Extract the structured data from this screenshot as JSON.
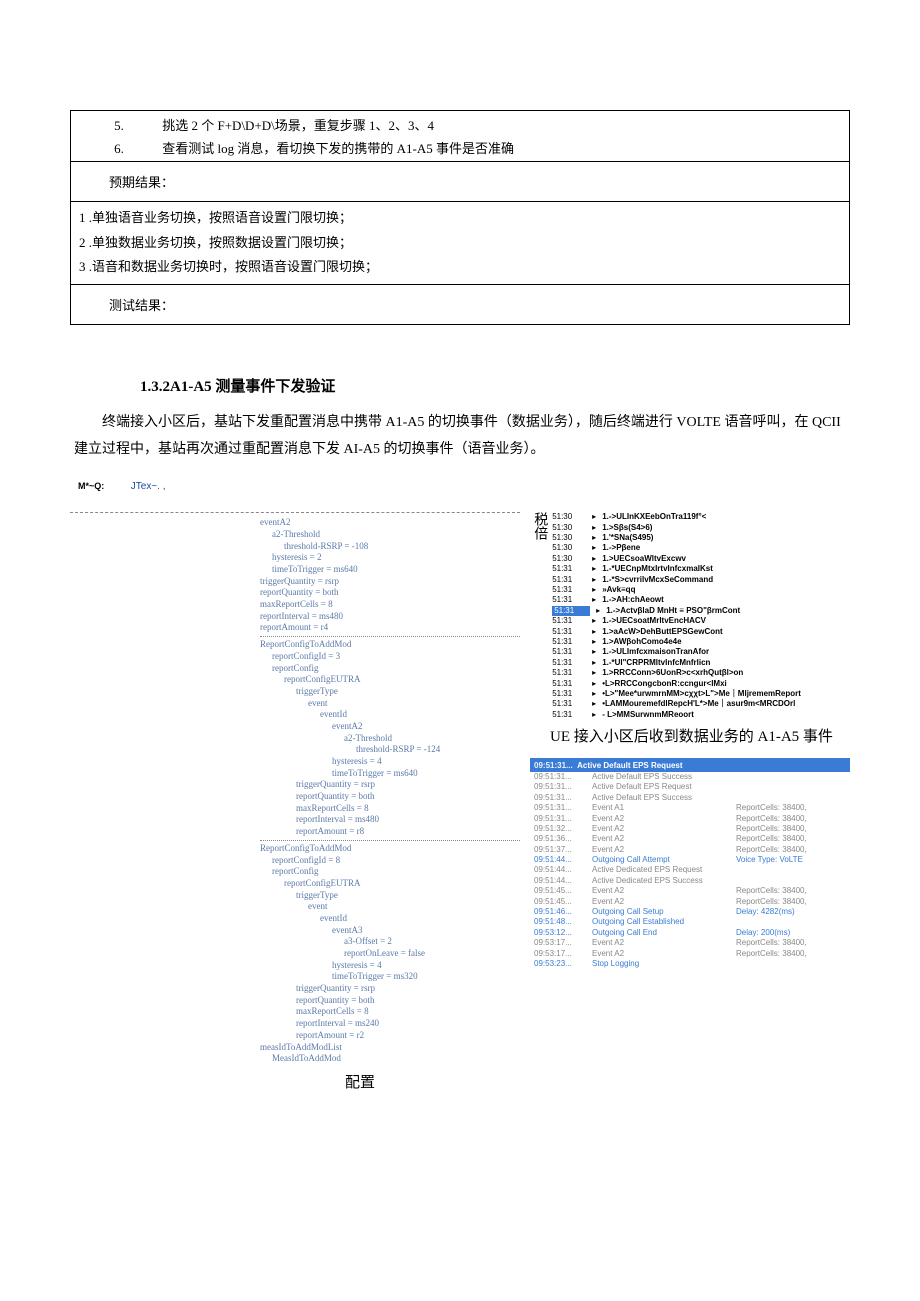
{
  "steps": {
    "s5_num": "5.",
    "s5_text": "挑选 2 个 F+D\\D+D\\场景，重复步骤 1、2、3、4",
    "s6_num": "6.",
    "s6_text": "查看测试 log 消息，看切换下发的携带的 A1-A5 事件是否准确"
  },
  "expected_label": "预期结果：",
  "expected": {
    "l1_num": "1",
    "l1_text": ".单独语音业务切换，按照语音设置门限切换；",
    "l2_num": "2",
    "l2_text": ".单独数据业务切换，按照数据设置门限切换；",
    "l3_num": "3",
    "l3_text": ".语音和数据业务切换时，按照语音设置门限切换；"
  },
  "test_result_label": "测试结果：",
  "section_heading": "1.3.2A1-A5 测量事件下发验证",
  "paragraph": "终端接入小区后，基站下发重配置消息中携带 A1-A5 的切换事件（数据业务），随后终端进行 VOLTE 语音呼叫，在 QCII 建立过程中，基站再次通过重配置消息下发 AI-A5 的切换事件（语音业务）。",
  "top_left_labels": {
    "a": "M*~Q:",
    "b": "JTex~. ,"
  },
  "tree": [
    "eventA2",
    "  a2-Threshold",
    "    threshold-RSRP = -108",
    "  hysteresis = 2",
    "  timeToTrigger = ms640",
    "triggerQuantity = rsrp",
    "reportQuantity = both",
    "maxReportCells = 8",
    "reportInterval = ms480",
    "reportAmount = r4",
    "ReportConfigToAddMod",
    "  reportConfigId = 3",
    "  reportConfig",
    "    reportConfigEUTRA",
    "      triggerType",
    "        event",
    "          eventId",
    "            eventA2",
    "              a2-Threshold",
    "                threshold-RSRP = -124",
    "            hysteresis = 4",
    "            timeToTrigger = ms640",
    "      triggerQuantity = rsrp",
    "      reportQuantity = both",
    "      maxReportCells = 8",
    "      reportInterval = ms480",
    "      reportAmount = r8",
    "ReportConfigToAddMod",
    "  reportConfigId = 8",
    "  reportConfig",
    "    reportConfigEUTRA",
    "      triggerType",
    "        event",
    "          eventId",
    "            eventA3",
    "              a3-Offset = 2",
    "              reportOnLeave = false",
    "            hysteresis = 4",
    "            timeToTrigger = ms320",
    "      triggerQuantity = rsrp",
    "      reportQuantity = both",
    "      maxReportCells = 8",
    "      reportInterval = ms240",
    "      reportAmount = r2",
    "measIdToAddModList",
    "  MeasIdToAddMod"
  ],
  "cjk_side": "税倍",
  "log": [
    {
      "t": "51:30",
      "m": "1.->ULInKXEebOnTra119f°<"
    },
    {
      "t": "51:30",
      "m": "1.>Sβs(S4>6)"
    },
    {
      "t": "51:30",
      "m": "1.'*SNa(S495)"
    },
    {
      "t": "51:30",
      "m": "1.->Pβene"
    },
    {
      "t": "51:30",
      "m": "1.>UECsoaWltvExcwv"
    },
    {
      "t": "51:31",
      "m": "1.-*UECnpMtxIrtvInfcxmalKst"
    },
    {
      "t": "51:31",
      "m": "1.-*S>cvrrilvMcxSeCommand"
    },
    {
      "t": "51:31",
      "m": "»Avk≡qq"
    },
    {
      "t": "51:31",
      "m": "1.->AH:chAeowt"
    },
    {
      "t": "51:31",
      "m": "1.->ActvβlaD MnHt ≡ PSO\"βrmCont",
      "hl": true
    },
    {
      "t": "51:31",
      "m": "1.->UECsoatMrltvEncHACV"
    },
    {
      "t": "51:31",
      "m": "1.>aAcW>DehButtEPSGewCont"
    },
    {
      "t": "51:31",
      "m": "1.>AWβohComo4e4e"
    },
    {
      "t": "51:31",
      "m": "1.->ULImfcxmaisonTranAfor"
    },
    {
      "t": "51:31",
      "m": "1.-*UI\"CRPRMltvInfcMnfrlicn"
    },
    {
      "t": "51:31",
      "m": "1.>RRCConn>6UonR>c<xrhQutβl>on"
    },
    {
      "t": "51:31",
      "m": "•L>RRCCongcbonR:ccngur<IMxi"
    },
    {
      "t": "51:31",
      "m": "•L>\"Mee*urwmrnMM>cχχt>L\">Me｜MljrememReport"
    },
    {
      "t": "51:31",
      "m": "•LAMMouremefdlRepcH'L*>Me｜asur9m<MRCDOrl"
    },
    {
      "t": "51:31",
      "m": "- L>MMSurwnmMReoort"
    }
  ],
  "caption_right": "UE 接入小区后收到数据业务的 A1-A5 事件",
  "event_header": "Active Default EPS Request",
  "events": [
    {
      "t": "09:51:31...",
      "m": "Active Default EPS Success",
      "i": ""
    },
    {
      "t": "09:51:31...",
      "m": "Active Default EPS Request",
      "i": ""
    },
    {
      "t": "09:51:31...",
      "m": "Active Default EPS Success",
      "i": ""
    },
    {
      "t": "09:51:31...",
      "m": "Event A1",
      "i": "ReportCells: 38400,"
    },
    {
      "t": "09:51:31...",
      "m": "Event A2",
      "i": "ReportCells: 38400,"
    },
    {
      "t": "09:51:32...",
      "m": "Event A2",
      "i": "ReportCells: 38400,"
    },
    {
      "t": "09:51:36...",
      "m": "Event A2",
      "i": "ReportCells: 38400,"
    },
    {
      "t": "09:51:37...",
      "m": "Event A2",
      "i": "ReportCells: 38400,"
    },
    {
      "t": "09:51:44...",
      "m": "Outgoing Call Attempt",
      "i": "Voice Type: VoLTE",
      "blue": true
    },
    {
      "t": "09:51:44...",
      "m": "Active Dedicated EPS Request",
      "i": ""
    },
    {
      "t": "09:51:44...",
      "m": "Active Dedicated EPS Success",
      "i": ""
    },
    {
      "t": "09:51:45...",
      "m": "Event A2",
      "i": "ReportCells: 38400,"
    },
    {
      "t": "09:51:45...",
      "m": "Event A2",
      "i": "ReportCells: 38400,"
    },
    {
      "t": "09:51:46...",
      "m": "Outgoing Call Setup",
      "i": "Delay: 4282(ms)",
      "blue": true
    },
    {
      "t": "09:51:48...",
      "m": "Outgoing Call Established",
      "i": "",
      "blue": true
    },
    {
      "t": "09:53:12...",
      "m": "Outgoing Call End",
      "i": "Delay: 200(ms)",
      "blue": true
    },
    {
      "t": "09:53:17...",
      "m": "Event A2",
      "i": "ReportCells: 38400,"
    },
    {
      "t": "09:53:17...",
      "m": "Event A2",
      "i": "ReportCells: 38400,"
    },
    {
      "t": "09:53:23...",
      "m": "Stop Logging",
      "i": "",
      "blue": true
    }
  ],
  "config_label": "配置"
}
